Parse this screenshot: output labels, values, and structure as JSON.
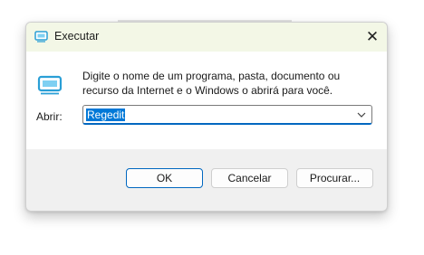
{
  "window": {
    "title": "Executar",
    "close_glyph": "✕"
  },
  "content": {
    "description": "Digite o nome de um programa, pasta, documento ou recurso da Internet e o Windows o abrirá para você.",
    "open_label": "Abrir:",
    "input_value": "Regedit"
  },
  "buttons": {
    "ok": "OK",
    "cancel": "Cancelar",
    "browse": "Procurar..."
  },
  "colors": {
    "accent": "#0067c0",
    "selection": "#0078d7",
    "titlebar": "#f3f7e6",
    "icon": "#2a9fd6"
  },
  "icons": {
    "title": "run-icon",
    "content": "run-icon",
    "close": "close-icon",
    "dropdown": "chevron-down-icon"
  }
}
